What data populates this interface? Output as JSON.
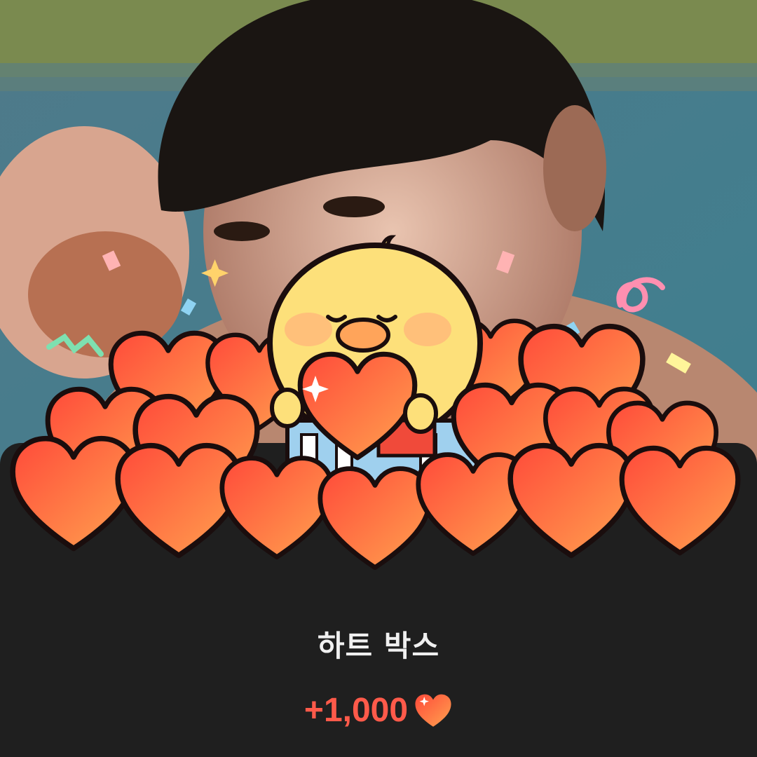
{
  "reward": {
    "title": "하트 박스",
    "amount": "+1,000",
    "icon": "heart-icon"
  },
  "colors": {
    "background": "#1f1f1f",
    "amount": "#ff5a4a",
    "heart_light": "#ff9c4f",
    "heart_dark": "#ff4a3a",
    "chick": "#fde07a"
  }
}
